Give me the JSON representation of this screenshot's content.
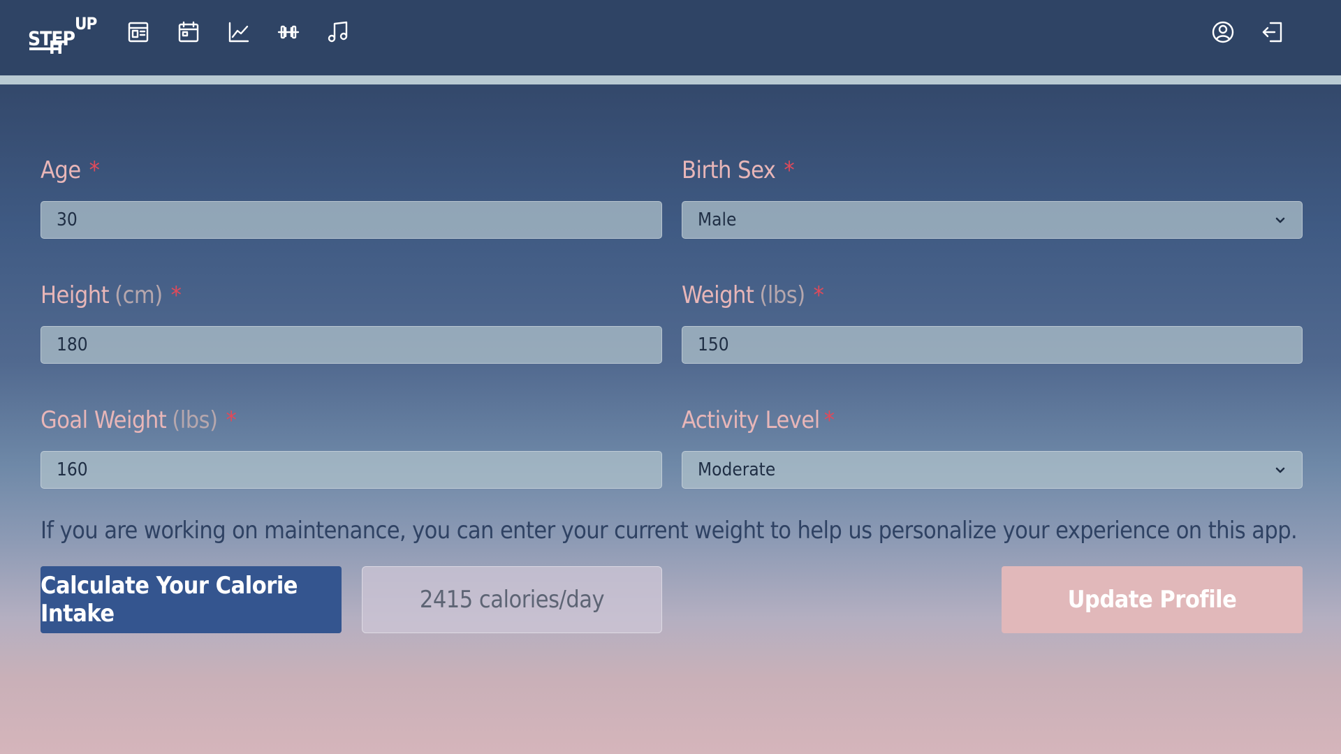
{
  "app": {
    "logo_line1": "STEP",
    "logo_sup": "UP",
    "logo_line2": "IT"
  },
  "nav": {
    "icons": [
      "document-icon",
      "calendar-icon",
      "chart-line-icon",
      "dumbbell-icon",
      "music-note-icon",
      "user-circle-icon",
      "logout-icon"
    ]
  },
  "form": {
    "age": {
      "label": "Age",
      "required": "*",
      "value": "30"
    },
    "birth_sex": {
      "label": "Birth Sex",
      "required": "*",
      "value": "Male"
    },
    "height": {
      "label": "Height",
      "unit": "(cm)",
      "required": "*",
      "value": "180"
    },
    "weight": {
      "label": "Weight",
      "unit": "(lbs)",
      "required": "*",
      "value": "150"
    },
    "goal_weight": {
      "label": "Goal Weight",
      "unit": "(lbs)",
      "required": "*",
      "value": "160"
    },
    "activity_level": {
      "label": "Activity Level",
      "required": "*",
      "value": "Moderate"
    }
  },
  "helper_text": "If you are working on maintenance, you can enter your current weight to help us personalize your experience on this app.",
  "actions": {
    "calculate_label": "Calculate Your Calorie Intake",
    "result": "2415 calories/day",
    "update_label": "Update Profile"
  },
  "colors": {
    "topbar": "#2f4465",
    "label": "#e8b6b8",
    "required": "#e04a5a",
    "calc_button": "#34558f",
    "update_button": "#e1b8ba"
  }
}
